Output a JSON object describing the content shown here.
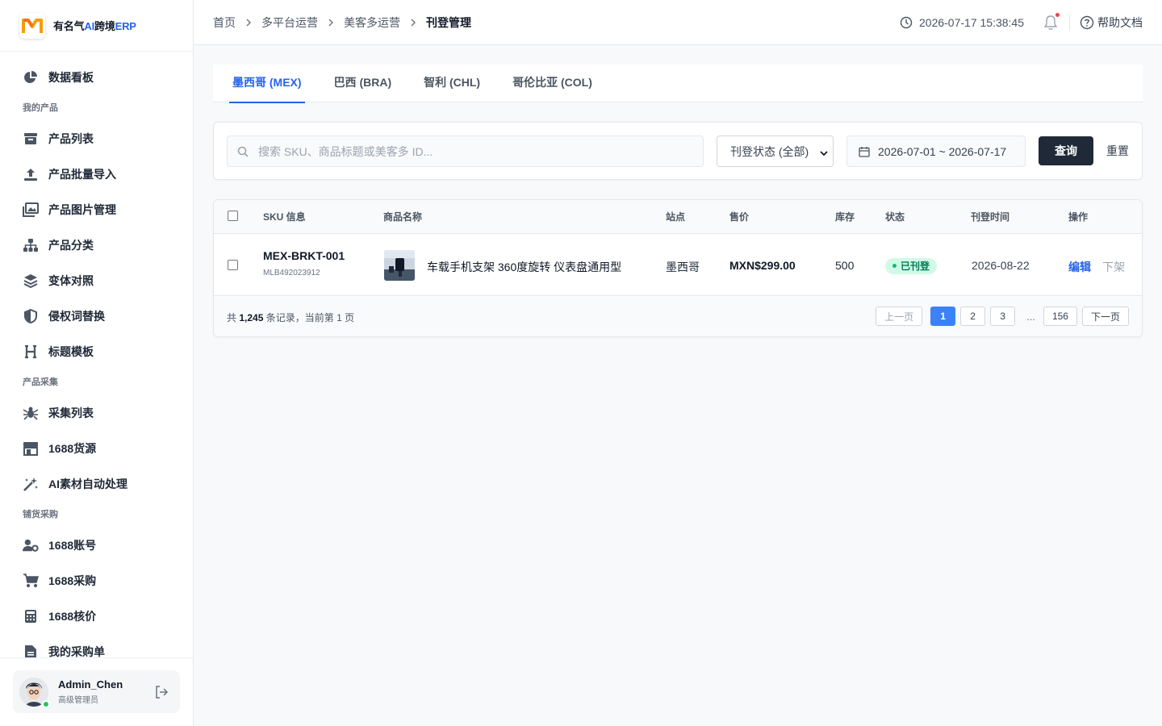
{
  "brand": {
    "prefix": "有名气",
    "ai": "AI",
    "middle": "跨境",
    "erp": "ERP"
  },
  "sidebar": {
    "dashboard": {
      "label": "数据看板",
      "icon": "pie-chart-icon"
    },
    "sections": [
      {
        "title": "我的产品",
        "items": [
          {
            "label": "产品列表",
            "icon": "box-icon"
          },
          {
            "label": "产品批量导入",
            "icon": "upload-icon"
          },
          {
            "label": "产品图片管理",
            "icon": "images-icon"
          },
          {
            "label": "产品分类",
            "icon": "sitemap-icon"
          },
          {
            "label": "变体对照",
            "icon": "layers-icon"
          },
          {
            "label": "侵权词替换",
            "icon": "shield-icon"
          },
          {
            "label": "标题模板",
            "icon": "heading-icon"
          }
        ]
      },
      {
        "title": "产品采集",
        "items": [
          {
            "label": "采集列表",
            "icon": "spider-icon"
          },
          {
            "label": "1688货源",
            "icon": "store-icon"
          },
          {
            "label": "AI素材自动处理",
            "icon": "magic-wand-icon"
          }
        ]
      },
      {
        "title": "铺货采购",
        "items": [
          {
            "label": "1688账号",
            "icon": "user-gear-icon"
          },
          {
            "label": "1688采购",
            "icon": "cart-icon"
          },
          {
            "label": "1688核价",
            "icon": "calculator-icon"
          },
          {
            "label": "我的采购单",
            "icon": "file-icon"
          }
        ]
      }
    ]
  },
  "user": {
    "name": "Admin_Chen",
    "role": "高级管理员"
  },
  "header": {
    "breadcrumb": [
      "首页",
      "多平台运营",
      "美客多运营",
      "刊登管理"
    ],
    "datetime": "2026-07-17 15:38:45",
    "help": "帮助文档"
  },
  "tabs": [
    "墨西哥 (MEX)",
    "巴西 (BRA)",
    "智利 (CHL)",
    "哥伦比亚 (COL)"
  ],
  "filter": {
    "search_placeholder": "搜索 SKU、商品标题或美客多 ID...",
    "status": "刊登状态 (全部)",
    "date_range": "2026-07-01 ~ 2026-07-17",
    "query": "查询",
    "reset": "重置"
  },
  "table": {
    "columns": [
      "SKU 信息",
      "商品名称",
      "站点",
      "售价",
      "库存",
      "状态",
      "刊登时间",
      "操作"
    ],
    "rows": [
      {
        "sku": "MEX-BRKT-001",
        "mlb_id": "MLB492023912",
        "name": "车载手机支架 360度旋转 仪表盘通用型",
        "site": "墨西哥",
        "price": "MXN$299.00",
        "stock": "500",
        "status": "已刊登",
        "time": "2026-08-22",
        "edit": "编辑",
        "offline": "下架"
      }
    ],
    "footer": {
      "prefix": "共",
      "total": "1,245",
      "suffix": "条记录，当前第 1 页"
    },
    "pager": {
      "prev": "上一页",
      "pages": [
        "1",
        "2",
        "3"
      ],
      "ellipsis": "...",
      "last": "156",
      "next": "下一页"
    }
  },
  "colors": {
    "accent": "#2563eb",
    "dark_button": "#1f2937",
    "success": "#10b981"
  }
}
